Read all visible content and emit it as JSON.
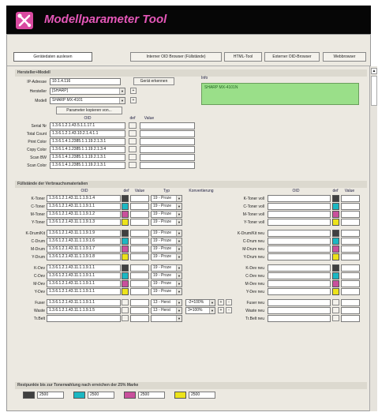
{
  "app": {
    "title": "Modellparameter Tool"
  },
  "tabs": [
    {
      "label": "Gerätedaten auslesen"
    },
    {
      "label": "Interner OID Browser (Füllstände)"
    },
    {
      "label": "HTML-Tool"
    },
    {
      "label": "Externer OID-Browser"
    },
    {
      "label": "Webbrowser"
    }
  ],
  "hersteller": {
    "section_title": "Hersteller+Modell",
    "ip_label": "IP-Adresse",
    "ip_value": "10.1.4.116",
    "detect_button": "Gerät erkennen",
    "info_label": "Info",
    "info_value": "SHARP MX-4101N",
    "manufacturer_label": "Hersteller",
    "manufacturer_value": "[SHARP]",
    "model_label": "Modell",
    "model_value": "SHARP MX-4101",
    "copy_button": "Parameter kopieren von...",
    "oid_header": "OID",
    "def_header": "def",
    "value_header": "Value",
    "rows": [
      {
        "label": "Serial Nr",
        "oid": "1.3.6.1.2.1.43.5.1.1.17.1"
      },
      {
        "label": "Total Count",
        "oid": "1.3.6.1.2.1.43.10.2.1.4.1.1"
      },
      {
        "label": "Print Color",
        "oid": "1.3.6.1.4.1.2385.1.1.19.2.1.3.1"
      },
      {
        "label": "Copy Color",
        "oid": "1.3.6.1.4.1.2385.1.1.19.2.1.3.4"
      },
      {
        "label": "Scan BW",
        "oid": "1.3.6.1.4.1.2385.1.1.19.2.1.3.1"
      },
      {
        "label": "Scan Color",
        "oid": "1.3.6.1.4.1.2385.1.1.19.2.1.3.1"
      }
    ]
  },
  "fuellstaende": {
    "section_title": "Füllstände der Verbrauchsmaterialien",
    "oid_header": "OID",
    "def_header": "def",
    "value_header": "Value",
    "typ_header": "Typ",
    "konv_header": "Konvertierung",
    "right_oid_header": "OID",
    "right_def_header": "def",
    "right_value_header": "Value",
    "left_rows": [
      {
        "label": "K-Toner",
        "oid": "1.3.6.1.2.1.43.11.1.1.9.1.4",
        "typ": "19 - Proze",
        "color": "black"
      },
      {
        "label": "C-Toner",
        "oid": "1.3.6.1.2.1.43.11.1.1.9.1.1",
        "typ": "19 - Proze",
        "color": "cyan"
      },
      {
        "label": "M-Toner",
        "oid": "1.3.6.1.2.1.43.11.1.1.9.1.2",
        "typ": "19 - Proze",
        "color": "magenta"
      },
      {
        "label": "Y-Toner",
        "oid": "1.3.6.1.2.1.43.11.1.1.9.1.3",
        "typ": "19 - Proze",
        "color": "yellow"
      },
      {
        "label": "K-Drum/Kit",
        "oid": "1.3.6.1.2.1.43.11.1.1.9.1.9",
        "typ": "19 - Proze",
        "color": "black"
      },
      {
        "label": "C-Drum",
        "oid": "1.3.6.1.2.1.43.11.1.1.9.1.6",
        "typ": "19 - Proze",
        "color": "cyan"
      },
      {
        "label": "M-Drum",
        "oid": "1.3.6.1.2.1.43.11.1.1.9.1.7",
        "typ": "19 - Proze",
        "color": "magenta"
      },
      {
        "label": "Y-Drum",
        "oid": "1.3.6.1.2.1.43.11.1.1.9.1.8",
        "typ": "19 - Proze",
        "color": "yellow"
      },
      {
        "label": "K-Dev",
        "oid": "1.3.6.1.2.1.43.11.1.1.9.1.1",
        "typ": "19 - Proze",
        "color": "black"
      },
      {
        "label": "C-Dev",
        "oid": "1.3.6.1.2.1.43.11.1.1.9.1.1",
        "typ": "19 - Proze",
        "color": "cyan"
      },
      {
        "label": "M-Dev",
        "oid": "1.3.6.1.2.1.43.11.1.1.9.1.1",
        "typ": "19 - Proze",
        "color": "magenta"
      },
      {
        "label": "Y-Dev",
        "oid": "1.3.6.1.2.1.43.11.1.1.9.1.1",
        "typ": "19 - Proze",
        "color": "yellow"
      },
      {
        "label": "Fuser",
        "oid": "1.3.6.1.2.1.43.11.1.1.9.1.1",
        "typ": "13 - Herst",
        "konv": "-2=100%",
        "color": ""
      },
      {
        "label": "Waste",
        "oid": "1.3.6.1.2.1.43.11.1.1.9.1.5",
        "typ": "13 - Herst",
        "konv": "3=100%",
        "color": ""
      },
      {
        "label": "Tr.Belt",
        "oid": "",
        "typ": "",
        "color": ""
      }
    ],
    "right_rows": [
      {
        "label": "K-Toner voll",
        "color": "black"
      },
      {
        "label": "C-Toner voll",
        "color": "cyan"
      },
      {
        "label": "M-Toner voll",
        "color": "magenta"
      },
      {
        "label": "Y-Toner voll",
        "color": "yellow"
      },
      {
        "label": "K-Drum/Kit neu",
        "color": "black"
      },
      {
        "label": "C-Drum neu",
        "color": "cyan"
      },
      {
        "label": "M-Drum neu",
        "color": "magenta"
      },
      {
        "label": "Y-Drum neu",
        "color": "yellow"
      },
      {
        "label": "K-Dev neu",
        "color": "black"
      },
      {
        "label": "C-Dev neu",
        "color": "cyan"
      },
      {
        "label": "M-Dev neu",
        "color": "magenta"
      },
      {
        "label": "Y-Dev neu",
        "color": "yellow"
      },
      {
        "label": "Fuser neu",
        "color": ""
      },
      {
        "label": "Waste neu",
        "color": ""
      },
      {
        "label": "Tr.Belt neu",
        "color": ""
      }
    ]
  },
  "restpunkte": {
    "section_title": "Restpunkte bis zur Tonerwahlung nach erreichen der 25% Marke",
    "items": [
      {
        "color": "black",
        "value": "2500"
      },
      {
        "color": "cyan",
        "value": "2500"
      },
      {
        "color": "magenta",
        "value": "2500"
      },
      {
        "color": "yellow",
        "value": "2500"
      }
    ]
  },
  "colors": {
    "black": "#404040",
    "cyan": "#1bb7c2",
    "magenta": "#c9509c",
    "yellow": "#ece31a",
    "info_green": "#9adf89",
    "title_pink": "#e557b8"
  },
  "icons": {
    "logo": "tools-icon"
  }
}
